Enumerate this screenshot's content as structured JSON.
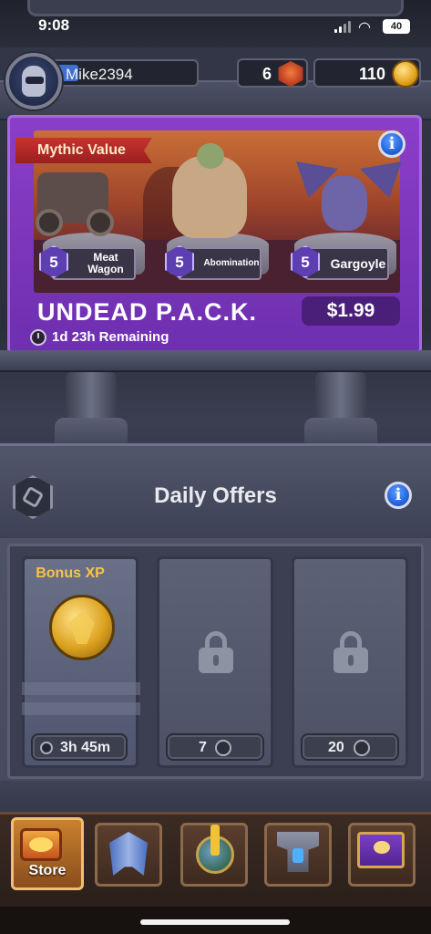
{
  "status_bar": {
    "time": "9:08",
    "battery": "40"
  },
  "header": {
    "username": "Mike2394",
    "gems": "6",
    "gold": "110"
  },
  "promo": {
    "banner": "Mythic Value",
    "units": [
      {
        "level": "5",
        "name": "Meat Wagon"
      },
      {
        "level": "5",
        "name": "Abomination"
      },
      {
        "level": "5",
        "name": "Gargoyle"
      }
    ],
    "title": "UNDEAD P.A.C.K.",
    "price": "$1.99",
    "remaining": "1d 23h Remaining"
  },
  "daily_offers": {
    "title": "Daily Offers",
    "slots": [
      {
        "label": "Bonus XP",
        "status": "3h 45m",
        "locked": false
      },
      {
        "label": "",
        "status": "7",
        "locked": true
      },
      {
        "label": "",
        "status": "20",
        "locked": true
      }
    ]
  },
  "nav": {
    "tabs": [
      {
        "label": "Store",
        "icon": "chest-icon",
        "active": true
      },
      {
        "label": "",
        "icon": "helmet-icon",
        "active": false
      },
      {
        "label": "",
        "icon": "globe-icon",
        "active": false
      },
      {
        "label": "",
        "icon": "anvil-icon",
        "active": false
      },
      {
        "label": "",
        "icon": "scroll-icon",
        "active": false
      }
    ]
  },
  "colors": {
    "promo_purple": "#7a35bd",
    "banner_red": "#b8292a",
    "gold_text": "#f5c542",
    "info_blue": "#2d6ee0"
  }
}
